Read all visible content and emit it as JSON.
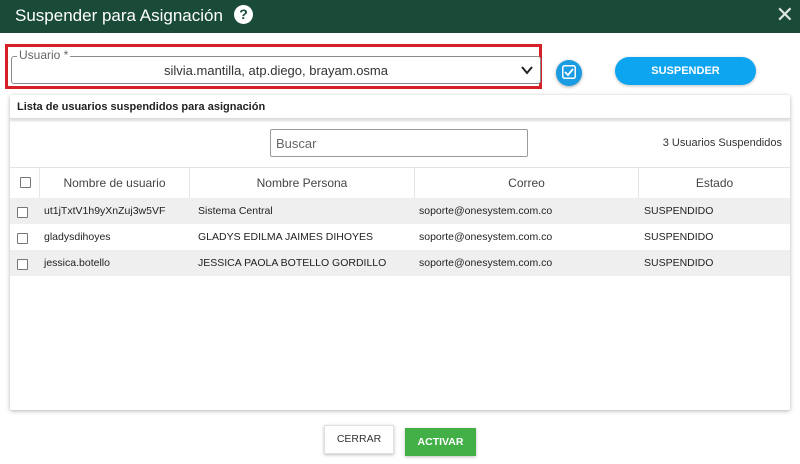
{
  "dialog": {
    "title": "Suspender para Asignación",
    "help_symbol": "?",
    "close_symbol": "✕"
  },
  "usuario_field": {
    "label": "Usuario *",
    "value": "silvia.mantilla, atp.diego, brayam.osma"
  },
  "actions": {
    "suspender_label": "SUSPENDER",
    "cerrar_label": "CERRAR",
    "activar_label": "ACTIVAR"
  },
  "panel": {
    "title": "Lista de usuarios suspendidos para asignación",
    "search_placeholder": "Buscar",
    "count_text": "3 Usuarios Suspendidos"
  },
  "table": {
    "columns": [
      "Nombre de usuario",
      "Nombre Persona",
      "Correo",
      "Estado"
    ],
    "rows": [
      [
        "ut1jTxtV1h9yXnZuj3w5VF",
        "Sistema Central",
        "soporte@onesystem.com.co",
        "SUSPENDIDO"
      ],
      [
        "gladysdihoyes",
        "GLADYS EDILMA JAIMES DIHOYES",
        "soporte@onesystem.com.co",
        "SUSPENDIDO"
      ],
      [
        "jessica.botello",
        "JESSICA PAOLA BOTELLO GORDILLO",
        "soporte@onesystem.com.co",
        "SUSPENDIDO"
      ]
    ]
  },
  "colors": {
    "titlebar": "#1a4a38",
    "highlight_outline": "#d42026",
    "primary_button": "#0ea5f0",
    "activar_button": "#43b047"
  }
}
